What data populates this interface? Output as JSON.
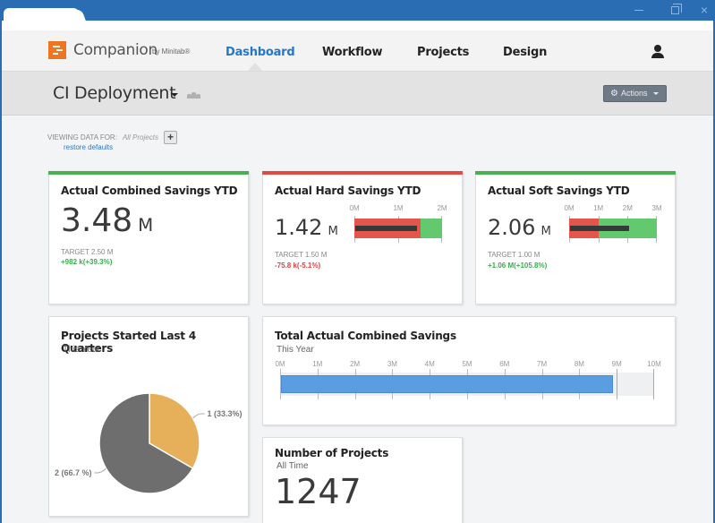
{
  "window": {
    "controls": {
      "minimize": "minimize",
      "maximize": "maximize",
      "close": "×"
    }
  },
  "brand": {
    "name": "Companion",
    "by": "by Minitab®",
    "logo_color": "#ee7622"
  },
  "nav": {
    "items": [
      {
        "label": "Dashboard",
        "active": true
      },
      {
        "label": "Workflow",
        "active": false
      },
      {
        "label": "Projects",
        "active": false
      },
      {
        "label": "Design",
        "active": false
      }
    ],
    "active_color": "#2278c9",
    "user_icon": "user-icon"
  },
  "subheader": {
    "title": "CI Deployment",
    "actions_label": "Actions",
    "actions_icon": "gear-icon"
  },
  "filter": {
    "label": "VIEWING DATA FOR:",
    "value": "All Projects",
    "add_label": "+",
    "restore_label": "restore defaults"
  },
  "colors": {
    "good": "#47b04f",
    "bad": "#e24b42",
    "band_bad": "#e4554c",
    "band_good": "#62c96e",
    "bar_blue": "#5a9de0"
  },
  "cards": {
    "combined": {
      "title": "Actual Combined Savings YTD",
      "value": "3.48",
      "unit": "M",
      "target": "TARGET 2.50 M",
      "delta": "+982 k(+39.3%)",
      "status": "good"
    },
    "hard": {
      "title": "Actual Hard Savings YTD",
      "value": "1.42",
      "unit": "M",
      "target": "TARGET 1.50 M",
      "delta": "-75.8 k(-5.1%)",
      "status": "bad",
      "bullet": {
        "ticks": [
          "0M",
          "1M",
          "2M"
        ],
        "max": 2,
        "bad_until": 1.5,
        "actual": 1.42
      }
    },
    "soft": {
      "title": "Actual Soft Savings YTD",
      "value": "2.06",
      "unit": "M",
      "target": "TARGET 1.00 M",
      "delta": "+1.06 M(+105.8%)",
      "status": "good",
      "bullet": {
        "ticks": [
          "0M",
          "1M",
          "2M",
          "3M"
        ],
        "max": 3,
        "bad_until": 1.0,
        "actual": 2.06
      }
    },
    "projects_started": {
      "title": "Projects Started Last 4 Quarters",
      "subtitle": "This Year"
    },
    "total": {
      "title": "Total Actual Combined Savings",
      "subtitle": "This Year",
      "ticks": [
        "0M",
        "1M",
        "2M",
        "3M",
        "4M",
        "5M",
        "6M",
        "7M",
        "8M",
        "9M",
        "10M"
      ],
      "max": 10,
      "band_until": 9,
      "value": 8.9
    },
    "num_projects": {
      "title": "Number of Projects",
      "subtitle": "All Time",
      "value": "1247"
    }
  },
  "chart_data": {
    "type": "pie",
    "title": "Projects Started Last 4 Quarters",
    "subtitle": "This Year",
    "slices": [
      {
        "label": "1 (33.3%)",
        "value": 1,
        "percent": 33.3,
        "color": "#e6b05a"
      },
      {
        "label": "2 (66.7 %)",
        "value": 2,
        "percent": 66.7,
        "color": "#6e6e6e"
      }
    ]
  }
}
